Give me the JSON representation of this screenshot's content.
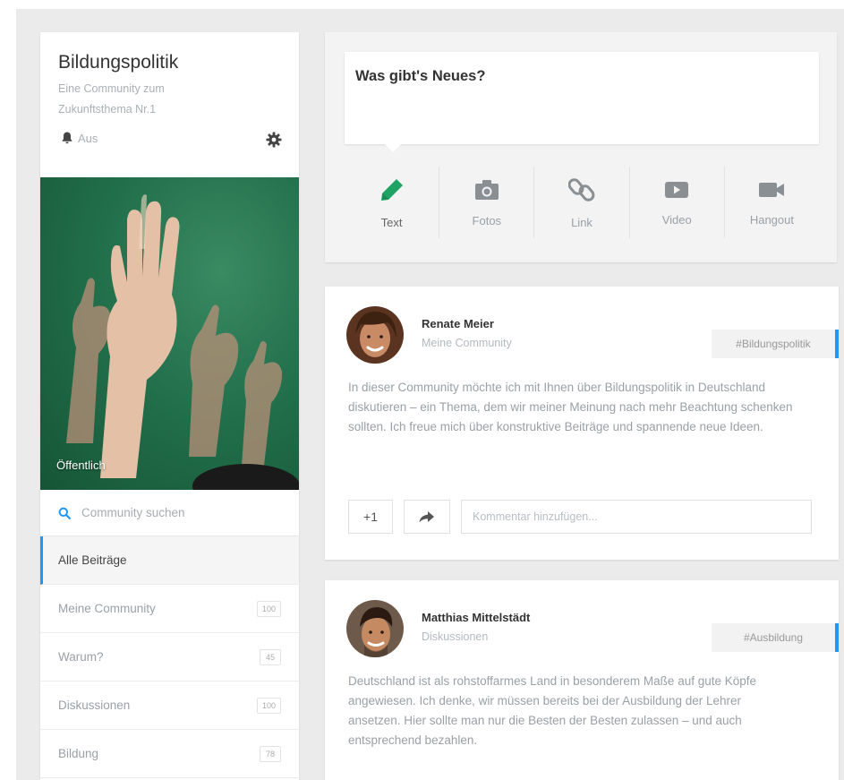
{
  "community": {
    "title": "Bildungspolitik",
    "subtitle": "Eine Community zum Zukunftsthema Nr.1",
    "notification_label": "Aus",
    "image_label": "Öffentlich",
    "search_placeholder": "Community suchen"
  },
  "sidebar": {
    "items": [
      {
        "label": "Alle Beiträge",
        "count": "",
        "active": true
      },
      {
        "label": "Meine Community",
        "count": "100",
        "active": false
      },
      {
        "label": "Warum?",
        "count": "45",
        "active": false
      },
      {
        "label": "Diskussionen",
        "count": "100",
        "active": false
      },
      {
        "label": "Bildung",
        "count": "78",
        "active": false
      }
    ]
  },
  "composer": {
    "prompt": "Was gibt's Neues?",
    "actions": [
      {
        "label": "Text",
        "icon": "pencil-icon"
      },
      {
        "label": "Fotos",
        "icon": "camera-icon"
      },
      {
        "label": "Link",
        "icon": "link-icon"
      },
      {
        "label": "Video",
        "icon": "video-play-icon"
      },
      {
        "label": "Hangout",
        "icon": "video-camera-icon"
      }
    ],
    "accent": "#1ea362"
  },
  "posts": [
    {
      "author": "Renate Meier",
      "community": "Meine Community",
      "tag": "#Bildungspolitik",
      "text": "In dieser Community möchte ich mit Ihnen über Bildungspolitik in Deutschland diskutieren – ein Thema, dem wir meiner Meinung nach mehr Beachtung schenken sollten. Ich freue mich über konstruktive Beiträge und spannende neue Ideen.",
      "plus_label": "+1",
      "comment_placeholder": "Kommentar hinzufügen..."
    },
    {
      "author": "Matthias Mittelstädt",
      "community": "Diskussionen",
      "tag": "#Ausbildung",
      "text": "Deutschland ist als rohstoffarmes Land in besonderem Maße auf gute Köpfe angewiesen. Ich denke, wir müssen bereits bei der Ausbildung der Lehrer ansetzen. Hier sollte man nur die Besten der Besten zulassen – und auch entsprechend bezahlen."
    }
  ],
  "colors": {
    "accent_blue": "#2196f3",
    "green_chalkboard": "#22704c",
    "search_icon": "#2196f3"
  }
}
